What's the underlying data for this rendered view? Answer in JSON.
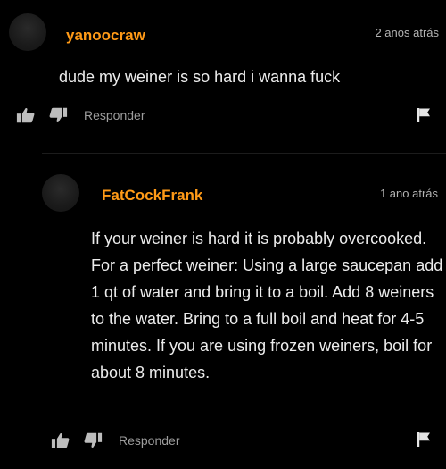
{
  "comments": [
    {
      "username": "yanoocraw",
      "timestamp": "2 anos atrás",
      "text": "dude my weiner is so hard i wanna fuck",
      "reply_label": "Responder"
    },
    {
      "username": "FatCockFrank",
      "timestamp": "1 ano atrás",
      "text": "If your weiner is hard it is probably overcooked. For a perfect weiner: Using a large saucepan add 1 qt of water and bring it to a boil. Add 8 weiners to the water. Bring to a full boil and heat for 4-5 minutes. If you are using frozen weiners, boil for about 8 minutes.",
      "reply_label": "Responder"
    }
  ],
  "colors": {
    "background": "#000000",
    "username": "#ff9a17",
    "text": "#ececec",
    "muted": "#9d9d9d"
  },
  "icons": [
    "thumbs-up-icon",
    "thumbs-down-icon",
    "flag-icon",
    "avatar"
  ]
}
